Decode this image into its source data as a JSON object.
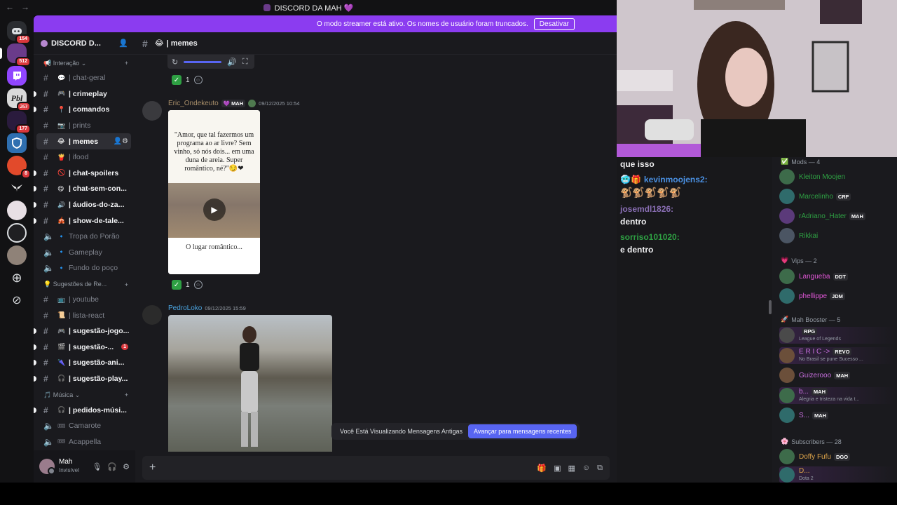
{
  "window": {
    "title": "DISCORD DA MAH 💜"
  },
  "colors": {
    "accent": "#5865f2",
    "banner": "#8b3cf0",
    "mod_green": "#2ea043"
  },
  "banner": {
    "text": "O modo streamer está ativo. Os nomes de usuário foram truncados.",
    "button": "Desativar"
  },
  "rail": {
    "badges": [
      "154",
      "512",
      "263",
      "177",
      "8"
    ]
  },
  "guild": {
    "name": "DISCORD D..."
  },
  "categories": {
    "interacao": "Interação",
    "sugestoes": "Sugestões de Re...",
    "musica": "Música"
  },
  "channels": [
    {
      "name": "| chat-geral",
      "emoji": "💬",
      "type": "text",
      "unread": false
    },
    {
      "name": "| crimeplay",
      "emoji": "🎮",
      "type": "text",
      "unread": true
    },
    {
      "name": "| comandos",
      "emoji": "📍",
      "type": "text",
      "unread": true
    },
    {
      "name": "| prints",
      "emoji": "📷",
      "type": "text",
      "unread": false
    },
    {
      "name": "| memes",
      "emoji": "😂",
      "type": "text",
      "active": true
    },
    {
      "name": "| ifood",
      "emoji": "🍟",
      "type": "text",
      "unread": false
    },
    {
      "name": "| chat-spoilers",
      "emoji": "🚫",
      "type": "text",
      "unread": true
    },
    {
      "name": "| chat-sem-con...",
      "emoji": "😋",
      "type": "text",
      "unread": true
    },
    {
      "name": "| áudios-do-za...",
      "emoji": "🔊",
      "type": "text",
      "unread": true
    },
    {
      "name": "| show-de-tale...",
      "emoji": "🎪",
      "type": "text",
      "unread": true
    },
    {
      "name": "Tropa do Porão",
      "emoji": "🔹",
      "type": "voice"
    },
    {
      "name": "Gameplay",
      "emoji": "🔹",
      "type": "voice"
    },
    {
      "name": "Fundo do poço",
      "emoji": "🔹",
      "type": "voice"
    }
  ],
  "channels2": [
    {
      "name": "| youtube",
      "emoji": "📺",
      "type": "text",
      "unread": false
    },
    {
      "name": "| lista-react",
      "emoji": "📜",
      "type": "text",
      "unread": false
    },
    {
      "name": "| sugestão-jogo...",
      "emoji": "🎮",
      "type": "text",
      "unread": true
    },
    {
      "name": "| sugestão-...",
      "emoji": "🎬",
      "type": "text",
      "unread": true,
      "badge": "1"
    },
    {
      "name": "| sugestão-ani...",
      "emoji": "🌂",
      "type": "text",
      "unread": true
    },
    {
      "name": "| sugestão-play...",
      "emoji": "🎧",
      "type": "text",
      "unread": true
    }
  ],
  "channels3": [
    {
      "name": "| pedidos-músi...",
      "emoji": "🎧",
      "type": "text",
      "unread": true
    },
    {
      "name": "Camarote",
      "emoji": "🎟",
      "type": "voice"
    },
    {
      "name": "Acappella",
      "emoji": "🎟",
      "type": "voice"
    }
  ],
  "user": {
    "name": "Mah",
    "status": "Invisível"
  },
  "chat": {
    "channel": "| memes",
    "reactions": [
      {
        "emoji": "✅",
        "count": "1"
      },
      {
        "emoji": "✅",
        "count": "1"
      }
    ],
    "messages": [
      {
        "author": "Eric_Ondekeuto",
        "tag": "MAH",
        "timestamp": "09/12/2025 10:54",
        "media_text_top": "\"Amor, que tal fazermos um programa ao ar livre? Sem vinho, só nós dois... em uma duna de areia. Super romântico, né?\"😏❤",
        "media_text_bottom": "O lugar romântico..."
      },
      {
        "author": "PedroLoko",
        "timestamp": "09/12/2025 15:59"
      }
    ],
    "old_notice": "Você Está Visualizando Mensagens Antigas",
    "old_button": "Avançar para mensagens recentes"
  },
  "twitch": {
    "lines": [
      {
        "text": "que isso",
        "kind": "msg"
      },
      {
        "text": "kevinmoojens2:",
        "kind": "user",
        "color": "#4a90e2"
      },
      {
        "text": "josemdl1826:",
        "kind": "user",
        "color": "#8a6fb5"
      },
      {
        "text": "dentro",
        "kind": "msg"
      },
      {
        "text": "sorriso101020:",
        "kind": "user",
        "color": "#2ea043"
      },
      {
        "text": "e dentro",
        "kind": "msg"
      }
    ]
  },
  "members": {
    "mods_title": "Mods — 4",
    "vips_title": "Vips — 2",
    "booster_title": "Mah Booster — 5",
    "subs_title": "Subscribers — 28",
    "mods": [
      {
        "name": "Kleiton Moojen",
        "color": "#2ea043",
        "tag": ""
      },
      {
        "name": "Marcelinho",
        "color": "#2ea043",
        "tag": "CRF"
      },
      {
        "name": "rAdriano_Hater",
        "color": "#2ea043",
        "tag": "MAH"
      },
      {
        "name": "Rikkai",
        "color": "#2ea043",
        "tag": ""
      }
    ],
    "vips": [
      {
        "name": "Langueba",
        "color": "#e056d6",
        "tag": "DDT"
      },
      {
        "name": "phellippe",
        "color": "#e056d6",
        "tag": "JDM"
      }
    ],
    "boosters": [
      {
        "name": "",
        "color": "#c96fe0",
        "tag": "RPG",
        "sub": "League of Legends"
      },
      {
        "name": "Ε R I C ->",
        "color": "#c96fe0",
        "tag": "REVO",
        "sub": "No Brasil se pune Sucesso ..."
      },
      {
        "name": "Guizerooo",
        "color": "#c96fe0",
        "tag": "MAH",
        "sub": ""
      },
      {
        "name": "b...",
        "color": "#c96fe0",
        "tag": "MAH",
        "sub": "Alegria e tristeza na vida t..."
      },
      {
        "name": "S...",
        "color": "#c96fe0",
        "tag": "MAH",
        "sub": ""
      }
    ],
    "subs": [
      {
        "name": "Doffy Fufu",
        "color": "#e0a64a",
        "tag": "DGO",
        "sub": ""
      },
      {
        "name": "D...",
        "color": "#e0a64a",
        "tag": "",
        "sub": "Dota 2"
      }
    ]
  }
}
